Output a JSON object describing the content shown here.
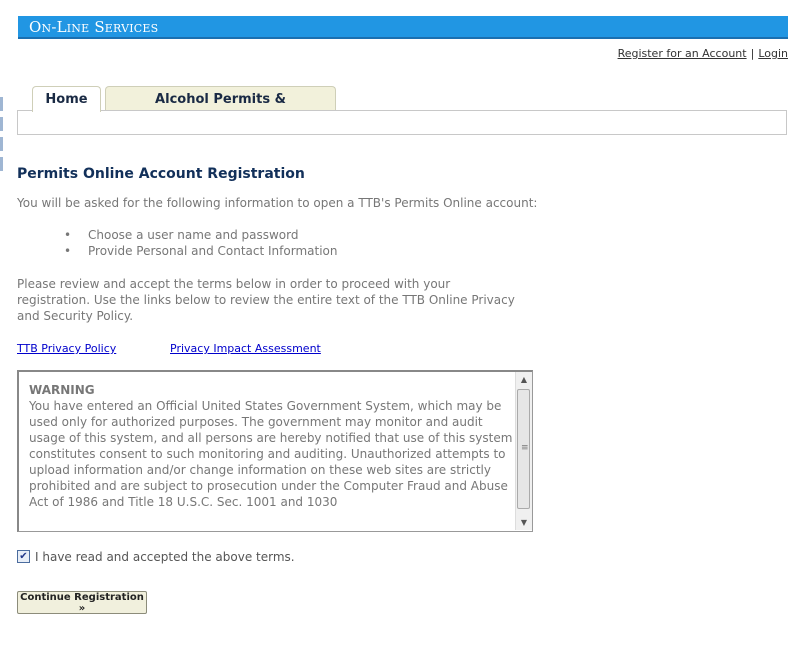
{
  "header": {
    "title": "On-Line Services",
    "links": {
      "register": "Register for an Account",
      "separator": "|",
      "login": "Login"
    }
  },
  "tabs": [
    {
      "label": "Home",
      "active": true
    },
    {
      "label": "Alcohol Permits & Registrations",
      "active": false
    }
  ],
  "main": {
    "heading": "Permits Online Account Registration",
    "intro": "You will be asked for the following information to open a TTB's Permits Online account:",
    "bullets": [
      "Choose a user name and password",
      "Provide Personal and Contact Information"
    ],
    "review_text": "Please review and accept the terms below in order to proceed with your registration. Use the links below to review the entire text of the TTB Online Privacy and Security Policy.",
    "links": {
      "privacy_policy": "TTB Privacy Policy",
      "privacy_impact": "Privacy Impact Assessment"
    },
    "warning": {
      "title": "WARNING",
      "body": "You have entered an Official United States Government System, which may be used only for authorized purposes.  The government may monitor and audit usage of this system, and all persons are hereby notified that use of this system constitutes consent to such monitoring and auditing.  Unauthorized attempts to upload information and/or change information on these web sites are strictly prohibited and are subject to prosecution under the Computer Fraud and Abuse Act of 1986 and Title 18 U.S.C. Sec. 1001 and 1030"
    },
    "accept": {
      "checked": true,
      "label": "I have read and accepted the above terms."
    },
    "continue_label": "Continue Registration »"
  },
  "colors": {
    "banner": "#2196e3",
    "heading": "#12305a",
    "tab_inactive": "#f2f1db",
    "link": "#0000cc"
  },
  "icons": {
    "checkbox": "check-mark-icon",
    "scroll_up": "scroll-up-arrow-icon",
    "scroll_down": "scroll-down-arrow-icon"
  }
}
